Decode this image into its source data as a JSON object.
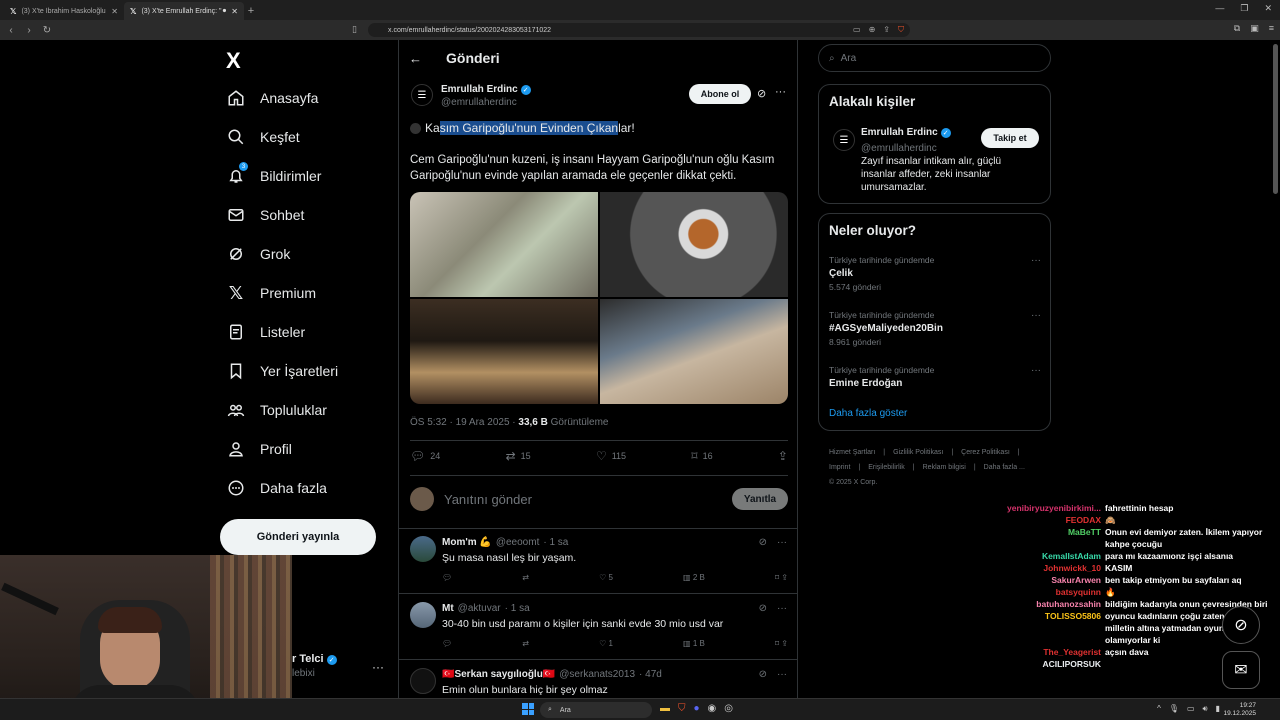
{
  "browser": {
    "tabs": [
      {
        "label": "(3) X'te İbrahim Haskoloğlu: \"🔴 #SO...",
        "active": false
      },
      {
        "label": "(3) X'te Emrullah Erdinç: \"⚫ Kas...",
        "active": true
      }
    ],
    "url": "x.com/emrullaherdinc/status/2002024283053171022"
  },
  "nav": {
    "logo": "X",
    "items": [
      {
        "label": "Anasayfa",
        "icon": "home-icon"
      },
      {
        "label": "Keşfet",
        "icon": "search-icon"
      },
      {
        "label": "Bildirimler",
        "icon": "bell-icon",
        "badge": "3"
      },
      {
        "label": "Sohbet",
        "icon": "mail-icon"
      },
      {
        "label": "Grok",
        "icon": "grok-icon"
      },
      {
        "label": "Premium",
        "icon": "x-premium-icon"
      },
      {
        "label": "Listeler",
        "icon": "list-icon"
      },
      {
        "label": "Yer İşaretleri",
        "icon": "bookmark-icon"
      },
      {
        "label": "Topluluklar",
        "icon": "communities-icon"
      },
      {
        "label": "Profil",
        "icon": "profile-icon"
      },
      {
        "label": "Daha fazla",
        "icon": "more-circle-icon"
      }
    ],
    "post_button": "Gönderi yayınla",
    "account_name": "r Telci",
    "account_handle": "lebixi"
  },
  "main": {
    "header_title": "Gönderi",
    "author": {
      "name": "Emrullah Erdinc",
      "handle": "@emrullaherdinc"
    },
    "subscribe": "Abone ol",
    "headline_pre": "Ka",
    "headline_highlight": "sım Garipoğlu'nun Evinden Çıkan",
    "headline_post": "lar!",
    "body": "Cem Garipoğlu'nun kuzeni, iş insanı Hayyam Garipoğlu'nun oğlu Kasım Garipoğlu'nun evinde yapılan aramada ele geçenler dikkat çekti.",
    "time": "ÖS 5:32 · 19 Ara 2025 · ",
    "views": "33,6 B",
    "views_label": " Görüntüleme",
    "stats": {
      "replies": "24",
      "reposts": "15",
      "likes": "115",
      "bookmarks": "16"
    },
    "reply_placeholder": "Yanıtını gönder",
    "reply_button": "Yanıtla",
    "replies": [
      {
        "name": "Mom'm 💪",
        "handle": "@eeoomt",
        "time": "· 1 sa",
        "text": "Şu masa nasıl leş bir yaşam.",
        "likes": "5",
        "views": "2 B",
        "retweets": "",
        "replies": ""
      },
      {
        "name": "Mt",
        "handle": "@aktuvar",
        "time": "· 1 sa",
        "text": "30-40 bin usd paramı o kişiler için sanki evde 30 mio usd var",
        "likes": "1",
        "views": "1 B",
        "retweets": "",
        "replies": ""
      },
      {
        "name": "🇹🇷Serkan saygılıoğlu🇹🇷",
        "handle": "@serkanats2013",
        "time": "· 47d",
        "text": "Emin olun bunlara hiç bir şey olmaz",
        "likes": "",
        "views": "",
        "retweets": "",
        "replies": ""
      }
    ]
  },
  "right": {
    "search_placeholder": "Ara",
    "related_title": "Alakalı kişiler",
    "related_user": {
      "name": "Emrullah Erdinc",
      "handle": "@emrullaherdinc",
      "bio": "Zayıf insanlar intikam alır, güçlü insanlar affeder, zeki insanlar umursamazlar.",
      "follow": "Takip et"
    },
    "trends_title": "Neler oluyor?",
    "trends": [
      {
        "category": "Türkiye tarihinde gündemde",
        "name": "Çelik",
        "count": "5.574 gönderi"
      },
      {
        "category": "Türkiye tarihinde gündemde",
        "name": "#AGSyeMaliyeden20Bin",
        "count": "8.961 gönderi"
      },
      {
        "category": "Türkiye tarihinde gündemde",
        "name": "Emine Erdoğan",
        "count": ""
      }
    ],
    "show_more": "Daha fazla göster",
    "footer": [
      "Hizmet Şartları",
      "|",
      "Gizlilik Politikası",
      "|",
      "Çerez Politikası",
      "|",
      "Imprint",
      "|",
      "Erişilebilirlik",
      "|",
      "Reklam bilgisi",
      "|",
      "Daha fazla ...",
      "© 2025 X Corp."
    ]
  },
  "chat": [
    {
      "user": "yenibiryuzyenibirkimi...",
      "color": "#d6336c",
      "msg": "fahrettinin hesap"
    },
    {
      "user": "FEODAX",
      "color": "#e03131",
      "msg": "🙈"
    },
    {
      "user": "MaBeTT",
      "color": "#51cf66",
      "msg": "Onun evi demiyor zaten. İkilem yapıyor kahpe çocuğu"
    },
    {
      "user": "KemalIstAdam",
      "color": "#38d9a9",
      "msg": "para mı kazaamıonz işçi alsanıa"
    },
    {
      "user": "Johnwickk_10",
      "color": "#e03131",
      "msg": "KASIM"
    },
    {
      "user": "SakurArwen",
      "color": "#f783ac",
      "msg": "ben takip etmiyom bu sayfaları aq"
    },
    {
      "user": "batsyquinn",
      "color": "#e03131",
      "msg": "🔥"
    },
    {
      "user": "batuhanozsahin",
      "color": "#f783ac",
      "msg": "bildiğim kadarıyla onun çevresinden biri"
    },
    {
      "user": "TOLISSO5806",
      "color": "#fcc419",
      "msg": "oyuncu kadınların çoğu zaten eskort, milletin altına yatmadan oyuncu olamıyorlar ki"
    },
    {
      "user": "The_Yeagerist",
      "color": "#e03131",
      "msg": "açsın dava"
    },
    {
      "user": "ACILIPORSUK",
      "color": "#e9ecef",
      "msg": ""
    }
  ],
  "taskbar": {
    "search": "Ara",
    "time": "19:27",
    "date": "19.12.2025"
  }
}
